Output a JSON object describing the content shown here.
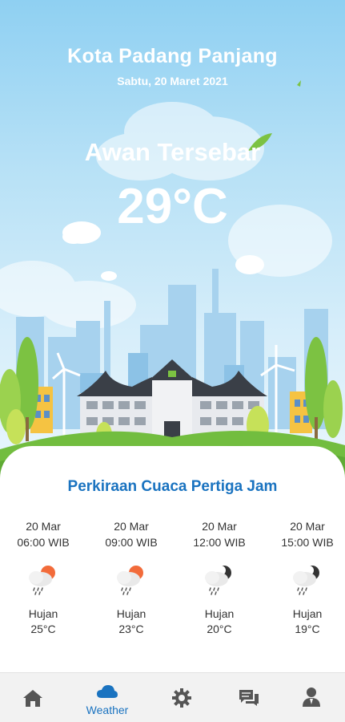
{
  "header": {
    "city": "Kota Padang Panjang",
    "date": "Sabtu, 20 Maret 2021",
    "condition": "Awan Tersebar",
    "temperature": "29°C"
  },
  "forecast_section": {
    "title": "Perkiraan Cuaca Pertiga Jam",
    "items": [
      {
        "date": "20 Mar",
        "time": "06:00 WIB",
        "icon": "rain-sun-icon",
        "condition": "Hujan",
        "temp": "25°C"
      },
      {
        "date": "20 Mar",
        "time": "09:00 WIB",
        "icon": "rain-sun-icon",
        "condition": "Hujan",
        "temp": "23°C"
      },
      {
        "date": "20 Mar",
        "time": "12:00 WIB",
        "icon": "rain-moon-icon",
        "condition": "Hujan",
        "temp": "20°C"
      },
      {
        "date": "20 Mar",
        "time": "15:00 WIB",
        "icon": "rain-moon-icon",
        "condition": "Hujan",
        "temp": "19°C"
      }
    ]
  },
  "navbar": {
    "items": [
      {
        "icon": "home-icon",
        "label": ""
      },
      {
        "icon": "cloud-icon",
        "label": "Weather",
        "active": true
      },
      {
        "icon": "gear-icon",
        "label": ""
      },
      {
        "icon": "chat-icon",
        "label": ""
      },
      {
        "icon": "user-icon",
        "label": ""
      }
    ]
  },
  "colors": {
    "accent": "#1a73c0",
    "sky": "#8fd0f2",
    "sun": "#f26b3a",
    "moon": "#333333"
  }
}
